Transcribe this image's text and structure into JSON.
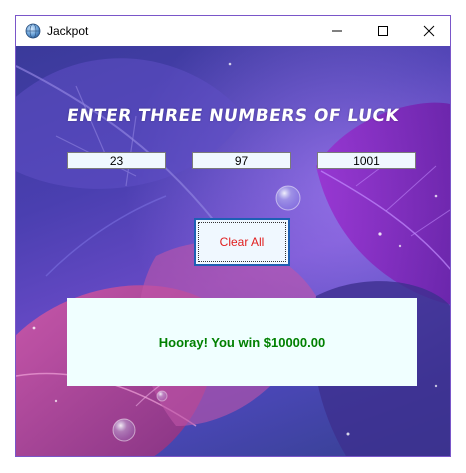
{
  "window": {
    "title": "Jackpot",
    "app_icon": "globe-icon",
    "controls": {
      "minimize_icon": "minimize-icon",
      "maximize_icon": "maximize-icon",
      "close_icon": "close-icon"
    }
  },
  "main": {
    "heading": "ENTER THREE NUMBERS OF LUCK",
    "inputs": [
      {
        "value": "23"
      },
      {
        "value": "97"
      },
      {
        "value": "1001"
      }
    ],
    "clear_button_label": "Clear All",
    "result_text": "Hooray! You win $10000.00"
  },
  "colors": {
    "clear_button_text": "#e01e1e",
    "result_text": "#008000",
    "panel_bg": "#f0ffff",
    "input_bg": "#f0f8ff",
    "window_border": "#7a56c9"
  }
}
